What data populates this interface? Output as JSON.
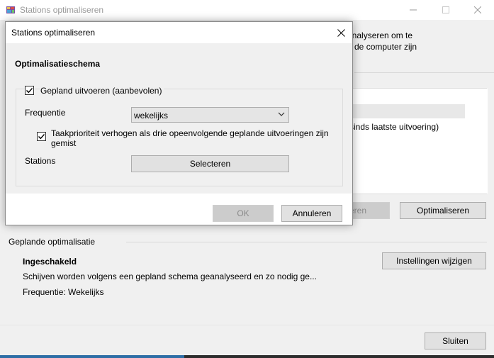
{
  "main": {
    "title": "Stations optimaliseren",
    "description_lines": [
      "analyseren om te",
      "p de computer zijn"
    ],
    "drive_status_partial": "sinds laatste uitvoering)",
    "analyze_label_partial": "eren",
    "optimize_label": "Optimaliseren",
    "scheduled": {
      "header": "Geplande optimalisatie",
      "status": "Ingeschakeld",
      "description": "Schijven worden volgens een gepland schema geanalyseerd en zo nodig ge...",
      "frequency": "Frequentie: Wekelijks",
      "change_settings_label": "Instellingen wijzigen"
    },
    "close_label": "Sluiten"
  },
  "dialog": {
    "title": "Stations optimaliseren",
    "heading": "Optimalisatieschema",
    "run_scheduled": {
      "label": "Gepland uitvoeren (aanbevolen)",
      "checked": true
    },
    "frequency_label": "Frequentie",
    "frequency_value": "wekelijks",
    "priority": {
      "label": "Taakprioriteit verhogen als drie opeenvolgende geplande uitvoeringen zijn gemist",
      "checked": true
    },
    "drives_label": "Stations",
    "select_label": "Selecteren",
    "ok_label": "OK",
    "cancel_label": "Annuleren"
  },
  "icons": {
    "app": "defrag-app-icon",
    "minimize": "minimize-icon",
    "maximize": "maximize-icon",
    "close": "close-icon",
    "dropdown": "chevron-down-icon",
    "check": "checkmark-icon"
  },
  "colors": {
    "window_bg": "#f0f0f0",
    "dialog_bg": "#ffffff",
    "button_bg": "#e1e1e1",
    "disabled_text": "#8a8a8a"
  }
}
